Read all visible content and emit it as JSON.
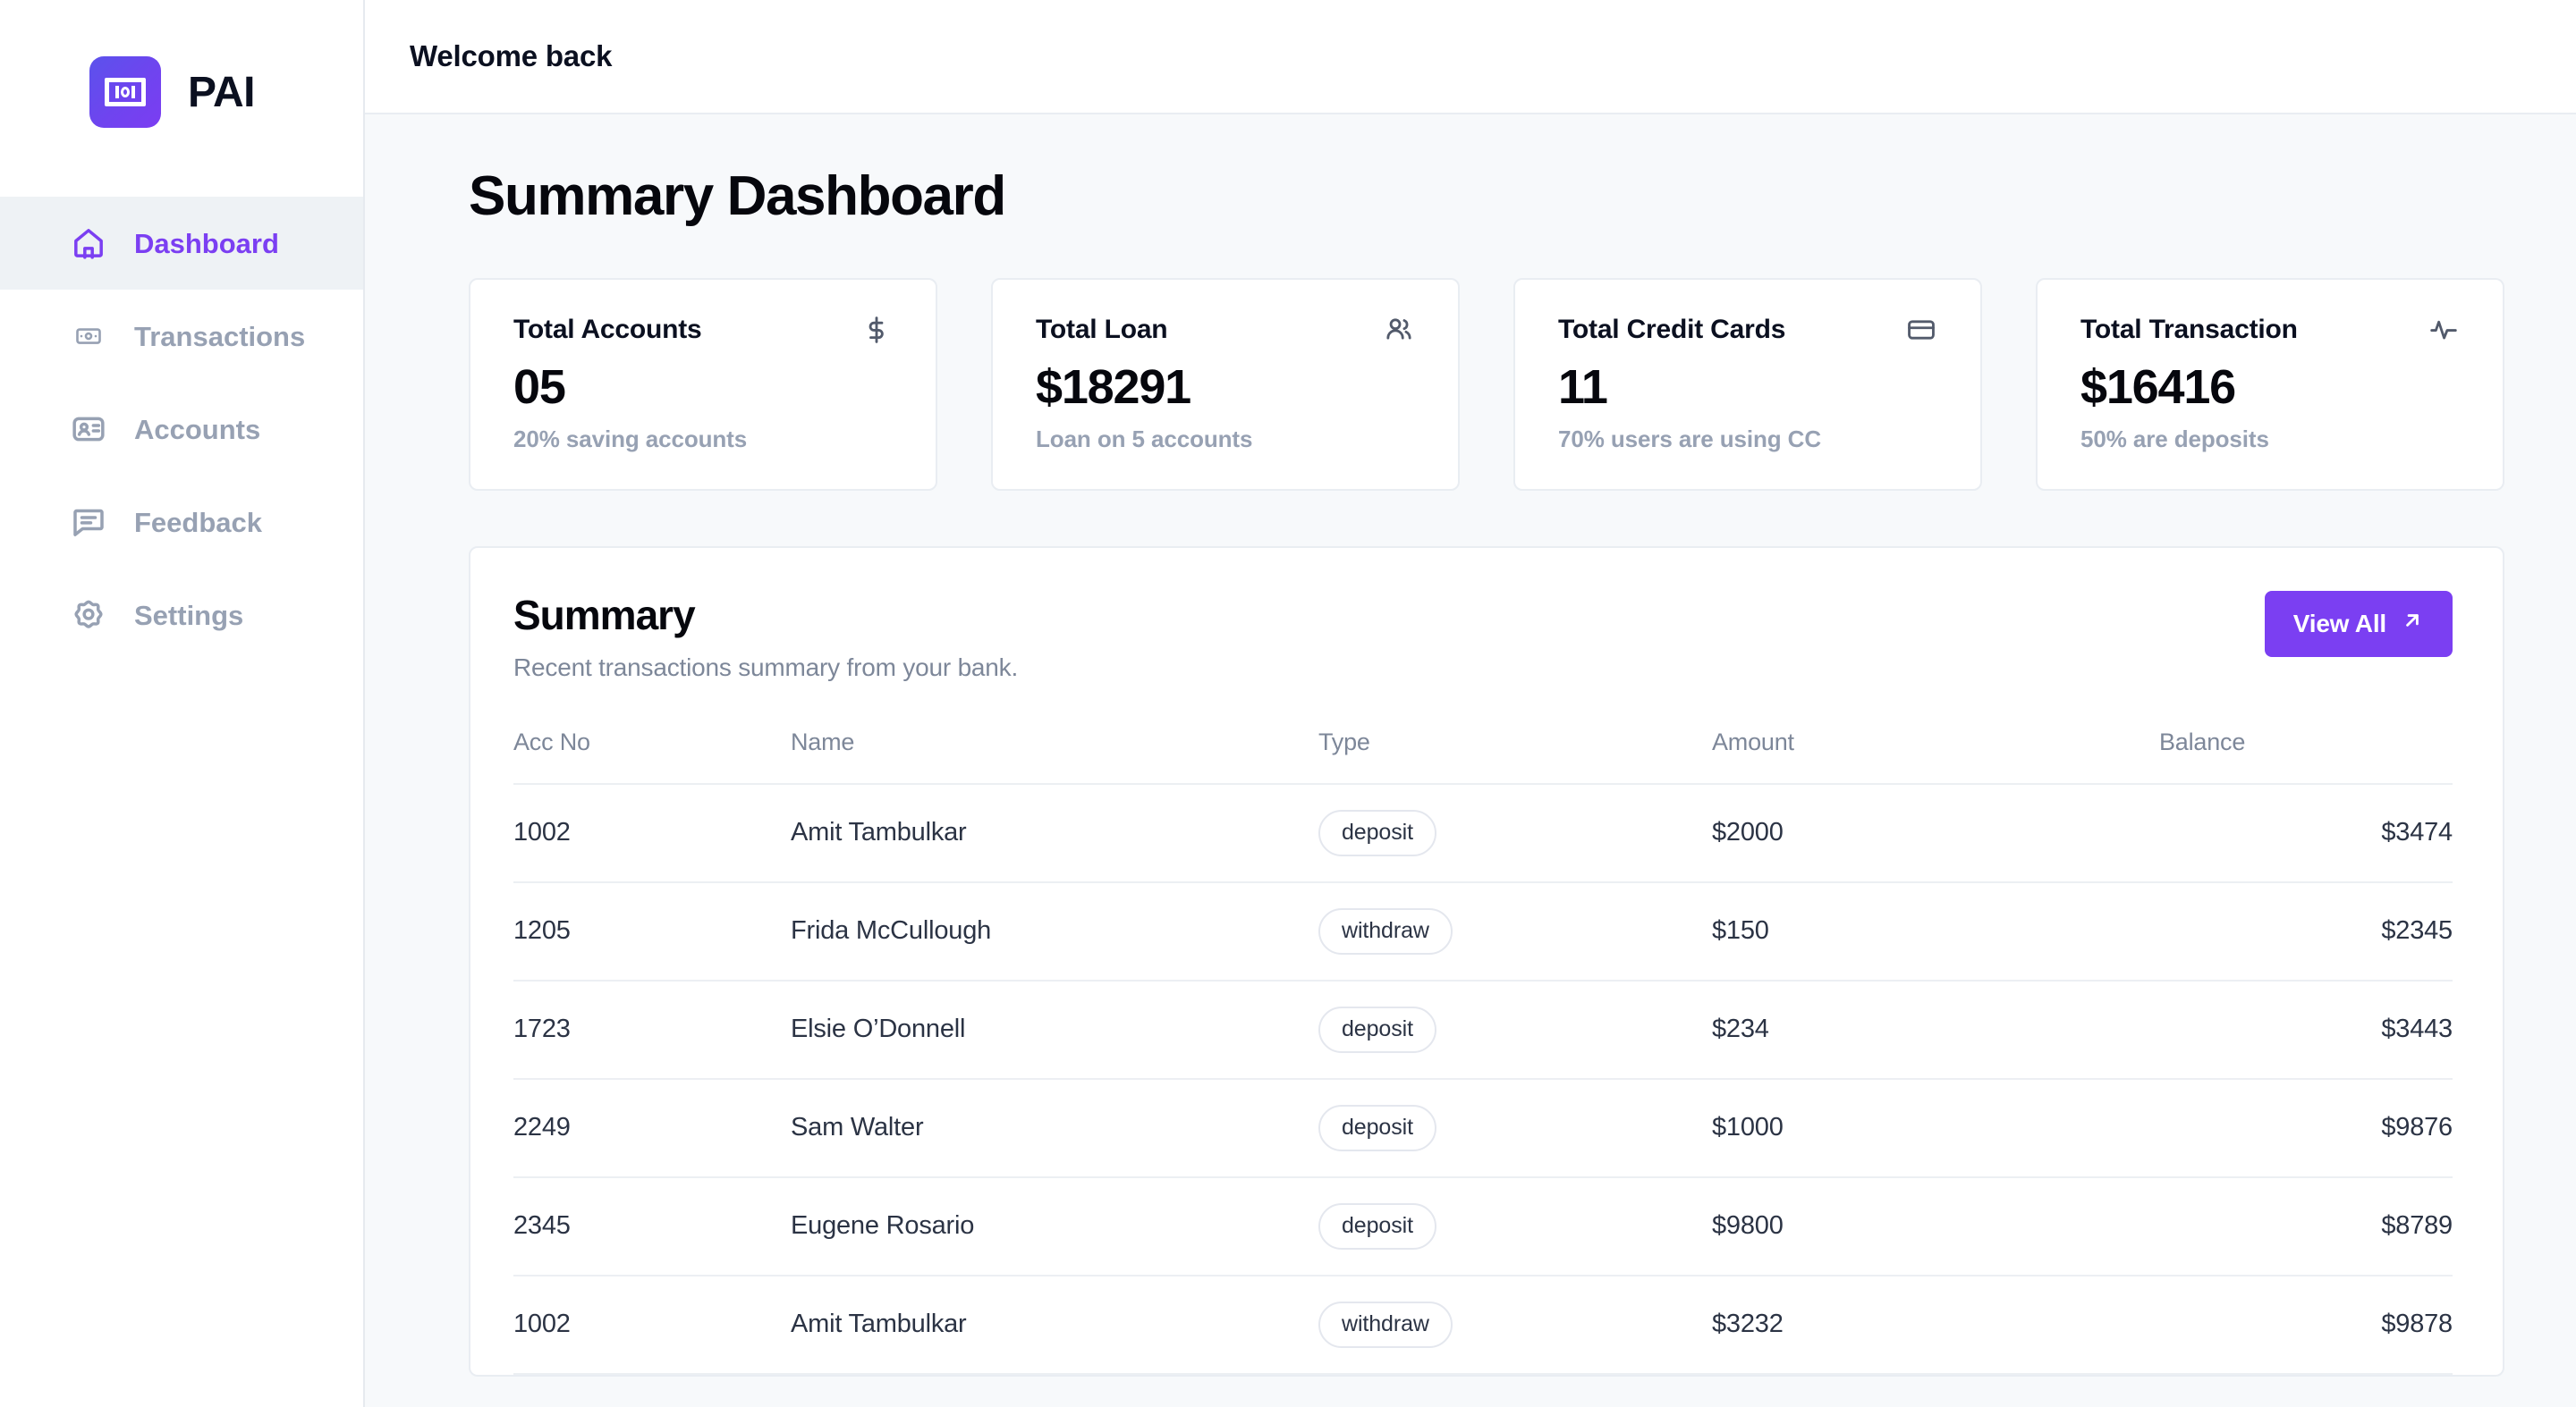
{
  "brand": {
    "name": "PAI",
    "logo_icon": "banknote-100-icon",
    "accent": "#7b3ff2"
  },
  "sidebar": {
    "items": [
      {
        "label": "Dashboard",
        "icon": "home-icon",
        "active": true
      },
      {
        "label": "Transactions",
        "icon": "banknote-icon",
        "active": false
      },
      {
        "label": "Accounts",
        "icon": "id-card-icon",
        "active": false
      },
      {
        "label": "Feedback",
        "icon": "chat-icon",
        "active": false
      },
      {
        "label": "Settings",
        "icon": "gear-icon",
        "active": false
      }
    ]
  },
  "topbar": {
    "title": "Welcome back"
  },
  "page": {
    "title": "Summary Dashboard"
  },
  "stats": [
    {
      "label": "Total Accounts",
      "value": "05",
      "sub": "20% saving accounts",
      "icon": "dollar-icon"
    },
    {
      "label": "Total Loan",
      "value": "$18291",
      "sub": "Loan on 5 accounts",
      "icon": "users-icon"
    },
    {
      "label": "Total Credit Cards",
      "value": "11",
      "sub": "70% users are using CC",
      "icon": "credit-card-icon"
    },
    {
      "label": "Total Transaction",
      "value": "$16416",
      "sub": "50% are deposits",
      "icon": "activity-icon"
    }
  ],
  "summary": {
    "title": "Summary",
    "subtitle": "Recent transactions summary from your bank.",
    "view_all_label": "View All",
    "view_all_icon": "arrow-up-right-icon",
    "columns": [
      "Acc No",
      "Name",
      "Type",
      "Amount",
      "Balance"
    ],
    "rows": [
      {
        "acc": "1002",
        "name": "Amit Tambulkar",
        "type": "deposit",
        "amount": "$2000",
        "balance": "$3474"
      },
      {
        "acc": "1205",
        "name": "Frida McCullough",
        "type": "withdraw",
        "amount": "$150",
        "balance": "$2345"
      },
      {
        "acc": "1723",
        "name": "Elsie O’Donnell",
        "type": "deposit",
        "amount": "$234",
        "balance": "$3443"
      },
      {
        "acc": "2249",
        "name": "Sam Walter",
        "type": "deposit",
        "amount": "$1000",
        "balance": "$9876"
      },
      {
        "acc": "2345",
        "name": "Eugene Rosario",
        "type": "deposit",
        "amount": "$9800",
        "balance": "$8789"
      },
      {
        "acc": "1002",
        "name": "Amit Tambulkar",
        "type": "withdraw",
        "amount": "$3232",
        "balance": "$9878"
      }
    ]
  }
}
